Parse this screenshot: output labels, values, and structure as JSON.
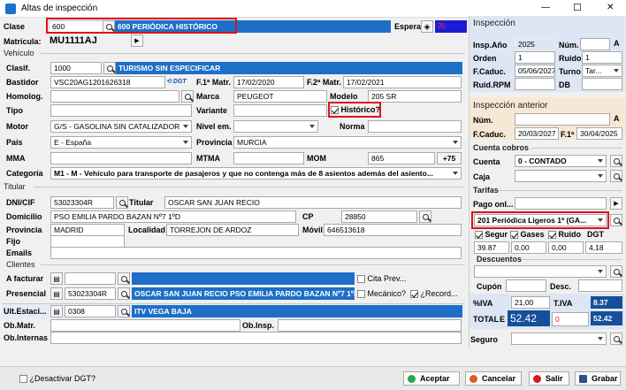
{
  "window": {
    "title": "Altas de inspección",
    "minimize": "—",
    "maximize": "☐",
    "close": "✕"
  },
  "clase": {
    "label": "Clase",
    "code": "600",
    "desc": "600 PERIÓDICA HISTÓRICO",
    "espera_label": "Espera",
    "espera_value": "20"
  },
  "matricula": {
    "label": "Matrícula:",
    "value": "MU1111AJ"
  },
  "vehiculo": {
    "section": "Vehículo",
    "clasif_label": "Clasif.",
    "clasif_code": "1000",
    "clasif_desc": "TURISMO SIN ESPECIFICAR",
    "bastidor_label": "Bastidor",
    "bastidor": "VSC20AG1201626318",
    "dgt": "DGT",
    "f1matr_label": "F.1ª Matr.",
    "f1matr": "17/02/2020",
    "f2matr_label": "F.2ª Matr.",
    "f2matr": "17/02/2021",
    "homolog_label": "Homolog.",
    "marca_label": "Marca",
    "marca": "PEUGEOT",
    "modelo_label": "Modelo",
    "modelo": "205 SR",
    "tipo_label": "Tipo",
    "variante_label": "Variante",
    "historico_label": "Histórico?",
    "motor_label": "Motor",
    "motor": "G/S - GASOLINA SIN CATALIZADOR",
    "nivel_label": "Nivel em.",
    "norma_label": "Norma",
    "pais_label": "País",
    "pais": "E - España",
    "provincia_label": "Provincia",
    "provincia": "MURCIA",
    "mma_label": "MMA",
    "mtma_label": "MTMA",
    "mom_label": "MOM",
    "mom": "865",
    "plus75": "+75",
    "categoria_label": "Categoría",
    "categoria": "M1 - M - Vehículo para transporte de pasajeros y que no contenga más de 8 asientos además del asiento..."
  },
  "titular": {
    "section": "Titular",
    "dni_label": "DNI/CIF",
    "dni": "53023304R",
    "titular_label": "Titular",
    "titular": "OSCAR SAN JUAN RECIO",
    "domicilio_label": "Domicilio",
    "domicilio": "PSO EMILIA PARDO BAZAN Nº7 1ºD",
    "cp_label": "CP",
    "cp": "28850",
    "provincia_label": "Provincia",
    "provincia": "MADRID",
    "localidad_label": "Localidad",
    "localidad": "TORREJON DE ARDOZ",
    "movil_label": "Móvil",
    "movil": "646513618",
    "fijo_label": "Fijo",
    "emails_label": "Emails"
  },
  "clientes": {
    "section": "Clientes",
    "afacturar_label": "A facturar",
    "cita_label": "Cita Prev...",
    "presencial_label": "Presencial",
    "presencial_dni": "53023304R",
    "presencial_desc": "OSCAR SAN JUAN RECIO  PSO EMILIA PARDO BAZAN Nº7 1ºD",
    "mecanico_label": "Mecánico?",
    "record_label": "¿Record..."
  },
  "estacion": {
    "label": "Ult.Estaci...",
    "code": "0308",
    "desc": "ITV VEGA BAJA",
    "obmatr_label": "Ob.Matr.",
    "obinsp_label": "Ob.Insp.",
    "obinternas_label": "Ob.Internas"
  },
  "inspeccion": {
    "section": "Inspección",
    "anio_label": "Insp.Año",
    "anio": "2025",
    "num_label": "Núm.",
    "num_letter": "A",
    "orden_label": "Orden",
    "orden": "1",
    "ruido_label": "Ruido",
    "ruido": "1",
    "fcaduc_label": "F.Caduc.",
    "fcaduc": "05/06/2027",
    "turno_label": "Turno",
    "turno": "Tar...",
    "rpm_label": "Ruid.RPM",
    "db_label": "DB"
  },
  "anterior": {
    "section": "Inspección anterior",
    "num_label": "Núm.",
    "num_letter": "A",
    "fcaduc_label": "F.Caduc.",
    "fcaduc": "20/03/2027",
    "f1_label": "F.1ª",
    "f1": "30/04/2025"
  },
  "cobros": {
    "section": "Cuenta cobros",
    "cuenta_label": "Cuenta",
    "cuenta": "0 - CONTADO",
    "caja_label": "Caja"
  },
  "tarifas": {
    "section": "Tarifas",
    "pago_label": "Pago onl...",
    "tarifa": "201 Periódica Ligeros 1ª (GA...",
    "segur": "Segur",
    "gases": "Gases",
    "ruido": "Ruido",
    "dgt": "DGT",
    "v1": "39.87",
    "v2": "0,00",
    "v3": "0,00",
    "v4": "4,18"
  },
  "descuentos": {
    "section": "Descuentos",
    "cupon_label": "Cupón",
    "desc_label": "Desc."
  },
  "totales": {
    "iva_label": "%IVA",
    "iva": "21,00",
    "tiva_label": "T.IVA",
    "tiva": "8.37",
    "total_label": "TOTAL",
    "e": "E",
    "total": "52.42",
    "zero": "0",
    "total2": "52.42"
  },
  "seguro": {
    "label": "Seguro"
  },
  "footer": {
    "desactivar": "¿Desactivar DGT?",
    "aceptar": "Aceptar",
    "cancelar": "Cancelar",
    "salir": "Salir",
    "grabar": "Grabar"
  }
}
